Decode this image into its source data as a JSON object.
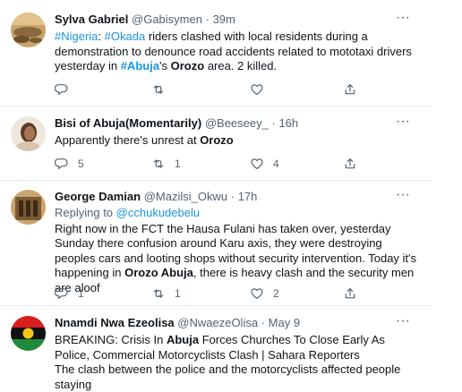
{
  "tweets": [
    {
      "name": "Sylva Gabriel",
      "handle": "@Gabisymen",
      "time": "39m",
      "text": [
        {
          "t": "#Nigeria",
          "c": "link"
        },
        {
          "t": ": ",
          "c": ""
        },
        {
          "t": "#Okada",
          "c": "link"
        },
        {
          "t": " riders clashed with local residents during a demonstration to denounce road accidents related to mototaxi drivers yesterday in ",
          "c": ""
        },
        {
          "t": "#Abuja",
          "c": "link bold"
        },
        {
          "t": "'s ",
          "c": ""
        },
        {
          "t": "Orozo",
          "c": "bold"
        },
        {
          "t": " area. 2 killed.",
          "c": ""
        }
      ],
      "counts": {
        "reply": "",
        "retweet": "",
        "like": ""
      }
    },
    {
      "name": "Bisi of Abuja(Momentarily)",
      "handle": "@Beeseey_",
      "time": "16h",
      "text": [
        {
          "t": "Apparently there's unrest at ",
          "c": ""
        },
        {
          "t": "Orozo",
          "c": "bold"
        }
      ],
      "counts": {
        "reply": "5",
        "retweet": "1",
        "like": "4"
      }
    },
    {
      "name": "George Damian",
      "handle": "@Mazilsi_Okwu",
      "time": "17h",
      "replying_prefix": "Replying to ",
      "replying_to": "@cchukudebelu",
      "text": [
        {
          "t": "Right now in the FCT the Hausa Fulani has taken over, yesterday Sunday there confusion around Karu axis, they were destroying peoples cars and looting shops without security intervention. Today it's happening in ",
          "c": ""
        },
        {
          "t": "Orozo Abuja",
          "c": "bold"
        },
        {
          "t": ", there is heavy clash and the security men are aloof",
          "c": ""
        }
      ],
      "counts": {
        "reply": "1",
        "retweet": "1",
        "like": "2"
      }
    },
    {
      "name": "Nnamdi Nwa Ezeolisa",
      "handle": "@NwaezeOlisa",
      "time": "May 9",
      "text": [
        {
          "t": "BREAKING: Crisis In ",
          "c": ""
        },
        {
          "t": "Abuja",
          "c": "bold"
        },
        {
          "t": " Forces Churches To Close Early As Police, Commercial Motorcyclists Clash | Sahara Reporters",
          "c": ""
        },
        {
          "t": "\nThe clash between the police and the motorcyclists affected people staying",
          "c": ""
        }
      ],
      "counts": {
        "reply": "",
        "retweet": "",
        "like": ""
      }
    }
  ],
  "icons": {
    "reply": "reply-icon",
    "retweet": "retweet-icon",
    "like": "heart-icon",
    "share": "share-icon",
    "more": "more-icon"
  },
  "colors": {
    "link": "#1b95e0",
    "secondary": "#536471",
    "divider": "#e6ecf0"
  },
  "more_glyph": "···"
}
